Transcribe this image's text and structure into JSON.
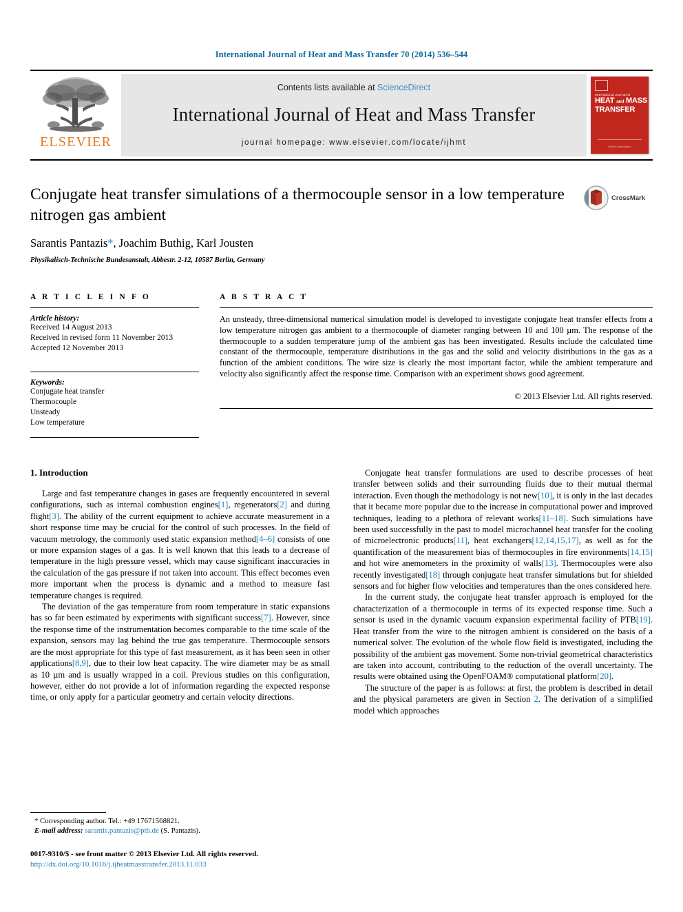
{
  "running_head": "International Journal of Heat and Mass Transfer 70 (2014) 536–544",
  "masthead": {
    "publisher_wordmark": "ELSEVIER",
    "contents_prefix": "Contents lists available at ",
    "sciencedirect": "ScienceDirect",
    "journal_title": "International Journal of Heat and Mass Transfer",
    "homepage": "journal homepage: www.elsevier.com/locate/ijhmt",
    "cover": {
      "sub": "International Journal of",
      "line1": "HEAT",
      "and": "and",
      "line2": "MASS",
      "line3": "TRANSFER",
      "foot": "Edition Information"
    }
  },
  "article": {
    "title": "Conjugate heat transfer simulations of a thermocouple sensor in a low temperature nitrogen gas ambient",
    "authors": "Sarantis Pantazis",
    "authors_rest": ", Joachim Buthig, Karl Jousten",
    "author_star": "*",
    "affiliation": "Physikalisch-Technische Bundesanstalt, Abbestr. 2-12, 10587 Berlin, Germany",
    "crossmark_label": "CrossMark"
  },
  "info": {
    "heading": "A R T I C L E    I N F O",
    "history_title": "Article history:",
    "history": [
      "Received 14 August 2013",
      "Received in revised form 11 November 2013",
      "Accepted 12 November 2013"
    ],
    "keywords_title": "Keywords:",
    "keywords": [
      "Conjugate heat transfer",
      "Thermocouple",
      "Unsteady",
      "Low temperature"
    ]
  },
  "abstract": {
    "heading": "A B S T R A C T",
    "text": "An unsteady, three-dimensional numerical simulation model is developed to investigate conjugate heat transfer effects from a low temperature nitrogen gas ambient to a thermocouple of diameter ranging between 10 and 100 µm. The response of the thermocouple to a sudden temperature jump of the ambient gas has been investigated. Results include the calculated time constant of the thermocouple, temperature distributions in the gas and the solid and velocity distributions in the gas as a function of the ambient conditions. The wire size is clearly the most important factor, while the ambient temperature and velocity also significantly affect the response time. Comparison with an experiment shows good agreement.",
    "copyright": "© 2013 Elsevier Ltd. All rights reserved."
  },
  "introduction": {
    "heading": "1. Introduction",
    "left_paragraphs": [
      {
        "parts": [
          {
            "t": "Large and fast temperature changes in gases are frequently encountered in several configurations, such as internal combustion engines"
          },
          {
            "t": "[1]",
            "cite": true
          },
          {
            "t": ", regenerators"
          },
          {
            "t": "[2]",
            "cite": true
          },
          {
            "t": " and during flight"
          },
          {
            "t": "[3]",
            "cite": true
          },
          {
            "t": ". The ability of the current equipment to achieve accurate measurement in a short response time may be crucial for the control of such processes. In the field of vacuum metrology, the commonly used static expansion method"
          },
          {
            "t": "[4–6]",
            "cite": true
          },
          {
            "t": " consists of one or more expansion stages of a gas. It is well known that this leads to a decrease of temperature in the high pressure vessel, which may cause significant inaccuracies in the calculation of the gas pressure if not taken into account. This effect becomes even more important when the process is dynamic and a method to measure fast temperature changes is required."
          }
        ]
      },
      {
        "parts": [
          {
            "t": "The deviation of the gas temperature from room temperature in static expansions has so far been estimated by experiments with significant success"
          },
          {
            "t": "[7]",
            "cite": true
          },
          {
            "t": ". However, since the response time of the instrumentation becomes comparable to the time scale of the expansion, sensors may lag behind the true gas temperature. Thermocouple sensors are the most appropriate for this type of fast measurement, as it has been seen in other applications"
          },
          {
            "t": "[8,9]",
            "cite": true
          },
          {
            "t": ", due to their low heat capacity. The wire diameter may be as small as 10 µm and is usually wrapped in a coil. Previous studies on this configuration, however, either do not provide a lot of information regarding the expected response time, or only apply for a particular geometry and certain velocity directions."
          }
        ]
      }
    ],
    "right_paragraphs": [
      {
        "parts": [
          {
            "t": "Conjugate heat transfer formulations are used to describe processes of heat transfer between solids and their surrounding fluids due to their mutual thermal interaction. Even though the methodology is not new"
          },
          {
            "t": "[10]",
            "cite": true
          },
          {
            "t": ", it is only in the last decades that it became more popular due to the increase in computational power and improved techniques, leading to a plethora of relevant works"
          },
          {
            "t": "[11–18]",
            "cite": true
          },
          {
            "t": ". Such simulations have been used successfully in the past to model microchannel heat transfer for the cooling of microelectronic products"
          },
          {
            "t": "[11]",
            "cite": true
          },
          {
            "t": ", heat exchangers"
          },
          {
            "t": "[12,14,15,17]",
            "cite": true
          },
          {
            "t": ", as well as for the quantification of the measurement bias of thermocouples in fire environments"
          },
          {
            "t": "[14,15]",
            "cite": true
          },
          {
            "t": " and hot wire anemometers in the proximity of walls"
          },
          {
            "t": "[13]",
            "cite": true
          },
          {
            "t": ". Thermocouples were also recently investigated"
          },
          {
            "t": "[18]",
            "cite": true
          },
          {
            "t": " through conjugate heat transfer simulations but for shielded sensors and for higher flow velocities and temperatures than the ones considered here."
          }
        ]
      },
      {
        "parts": [
          {
            "t": "In the current study, the conjugate heat transfer approach is employed for the characterization of a thermocouple in terms of its expected response time. Such a sensor is used in the dynamic vacuum expansion experimental facility of PTB"
          },
          {
            "t": "[19]",
            "cite": true
          },
          {
            "t": ". Heat transfer from the wire to the nitrogen ambient is considered on the basis of a numerical solver. The evolution of the whole flow field is investigated, including the possibility of the ambient gas movement. Some non-trivial geometrical characteristics are taken into account, contributing to the reduction of the overall uncertainty. The results were obtained using the OpenFOAM® computational platform"
          },
          {
            "t": "[20]",
            "cite": true
          },
          {
            "t": "."
          }
        ]
      },
      {
        "parts": [
          {
            "t": "The structure of the paper is as follows: at first, the problem is described in detail and the physical parameters are given in Section "
          },
          {
            "t": "2",
            "cite": true
          },
          {
            "t": ". The derivation of a simplified model which approaches"
          }
        ]
      }
    ]
  },
  "footnote": {
    "star": "*",
    "corresponding": " Corresponding author. Tel.: +49 17671568821.",
    "email_label": "E-mail address:",
    "email": "sarantis.pantazis@ptb.de",
    "email_suffix": " (S. Pantazis)."
  },
  "footer": {
    "issn_line": "0017-9310/$ - see front matter © 2013 Elsevier Ltd. All rights reserved.",
    "doi": "http://dx.doi.org/10.1016/j.ijheatmasstransfer.2013.11.033"
  },
  "colors": {
    "link_blue": "#1f7fb5",
    "header_blue": "#0b6a9b",
    "elsevier_orange": "#e87b1e",
    "cover_red": "#c1271d",
    "band_gray": "#e6e6e6"
  }
}
